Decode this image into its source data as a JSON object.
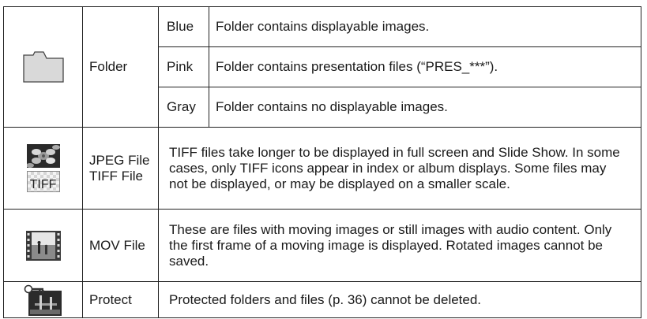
{
  "folder": {
    "label": "Folder",
    "variants": [
      {
        "color": "Blue",
        "description": "Folder contains displayable images."
      },
      {
        "color": "Pink",
        "description": "Folder contains presentation files (“PRES_***”)."
      },
      {
        "color": "Gray",
        "description": "Folder contains no displayable images."
      }
    ]
  },
  "jpeg_tiff": {
    "label_jpeg": "JPEG File",
    "label_tiff": "TIFF File",
    "icon_text": "TIFF",
    "description": "TIFF files take longer to be displayed in full screen and Slide Show. In some cases, only TIFF icons appear in index or album displays. Some files may not be displayed, or may be displayed on a smaller scale."
  },
  "mov": {
    "label": "MOV File",
    "description": "These are files with moving images or still images with audio content. Only the first frame of a moving image is displayed. Rotated images cannot be saved."
  },
  "protect": {
    "label": "Protect",
    "description": "Protected folders and files (p. 36) cannot be deleted."
  },
  "icons": [
    "folder-icon",
    "jpeg-thumbnail-icon",
    "tiff-icon",
    "mov-film-icon",
    "protect-key-icon"
  ]
}
